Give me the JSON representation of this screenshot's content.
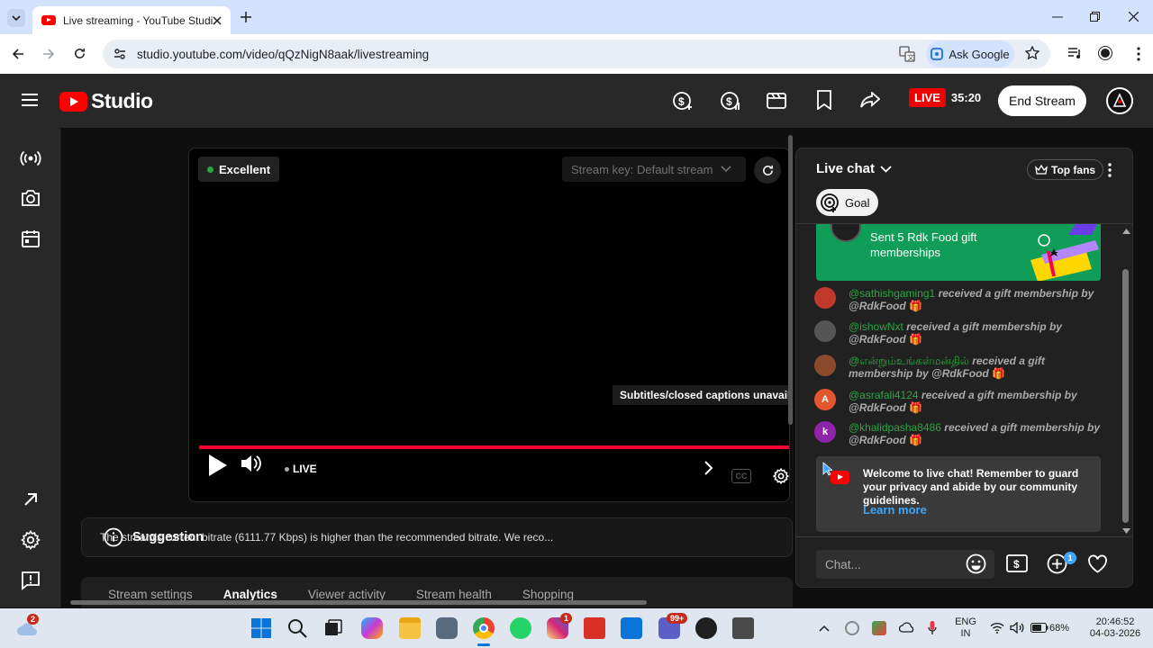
{
  "browser": {
    "tab_title": "Live streaming - YouTube Studio",
    "url": "studio.youtube.com/video/qQzNigN8aak/livestreaming",
    "ask_google": "Ask Google"
  },
  "header": {
    "brand": "Studio",
    "live_label": "LIVE",
    "live_time": "35:20",
    "end_stream": "End Stream"
  },
  "player": {
    "quality": "Excellent",
    "stream_key": "Stream key: Default stream",
    "subtitles_tip": "Subtitles/closed captions unavailable",
    "live": "LIVE",
    "cc": "CC"
  },
  "suggestion": {
    "label": "Suggestion",
    "message": "The stream's current bitrate (6111.77 Kbps) is higher than the recommended bitrate. We reco..."
  },
  "tabs": [
    "Stream settings",
    "Analytics",
    "Viewer activity",
    "Stream health",
    "Shopping"
  ],
  "chat": {
    "title": "Live chat",
    "top_fans": "Top fans",
    "goal": "Goal",
    "gift_card_text": "Sent 5 Rdk Food gift memberships",
    "messages": [
      {
        "user": "@sathishgaming1",
        "text": "received a gift membership by",
        "by": "@RdkFood",
        "avatar_color": "#c0392b",
        "initial": ""
      },
      {
        "user": "@ishowNxt",
        "text": "received a gift membership by",
        "by": "@RdkFood",
        "avatar_color": "#555555",
        "initial": ""
      },
      {
        "user": "@என்றும்உங்கள்மன்தில்",
        "text": "received a gift membership by",
        "by": "@RdkFood",
        "avatar_color": "#8b4a2b",
        "initial": ""
      },
      {
        "user": "@asrafali4124",
        "text": "received a gift membership by",
        "by": "@RdkFood",
        "avatar_color": "#e4572e",
        "initial": "A"
      },
      {
        "user": "@khalidpasha8486",
        "text": "received a gift membership by",
        "by": "@RdkFood",
        "avatar_color": "#8e24aa",
        "initial": "k"
      }
    ],
    "welcome": "Welcome to live chat! Remember to guard your privacy and abide by our community guidelines.",
    "learn_more": "Learn more",
    "input_placeholder": "Chat...",
    "plus_badge": "1"
  },
  "taskbar": {
    "weather_badge": "2",
    "instagram_badge": "1",
    "teams_badge": "99+",
    "lang": "ENG",
    "region": "IN",
    "battery": "68%",
    "time": "20:46:52",
    "date": "04-03-2026"
  }
}
